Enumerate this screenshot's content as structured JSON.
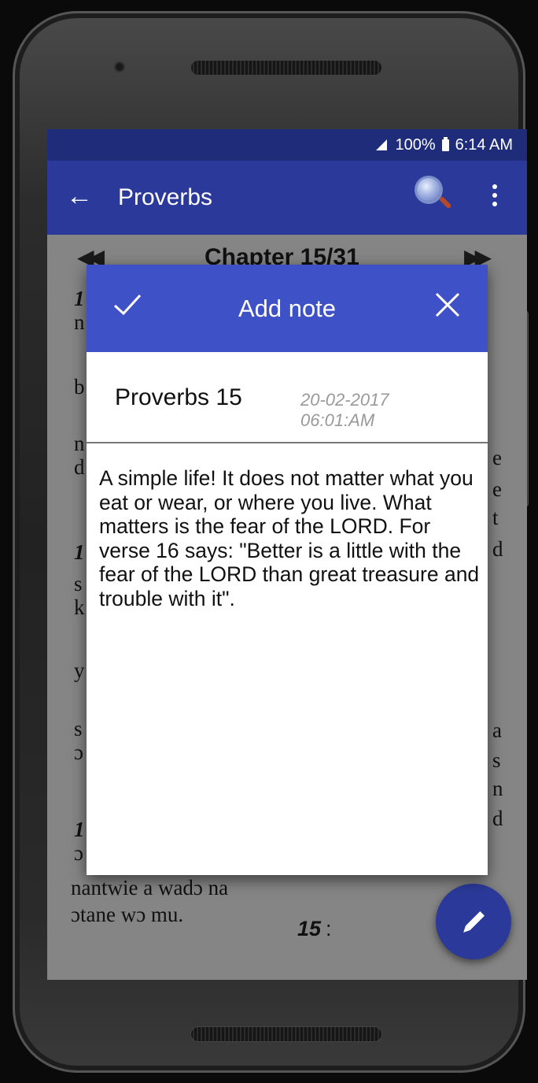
{
  "status_bar": {
    "battery": "100%",
    "time": "6:14 AM",
    "icons": [
      "signal-icon",
      "battery-icon"
    ]
  },
  "toolbar": {
    "title": "Proverbs",
    "icons": [
      "back-arrow-icon",
      "search-icon",
      "more-vert-icon"
    ]
  },
  "chapter_nav": {
    "title": "Chapter 15/31",
    "prev_icon": "double-chevron-left-icon",
    "next_icon": "double-chevron-right-icon"
  },
  "background_text": {
    "left_fragments": [
      "1",
      "n",
      "b",
      "n",
      "d",
      "1",
      "s",
      "k",
      "y",
      "s",
      "ɔ",
      "1",
      "ɔ"
    ],
    "right_fragments": [
      "e",
      "e",
      "t",
      "d",
      "a",
      "s",
      "n",
      "d"
    ],
    "line1": "nantwie a wadɔ na",
    "line2": "ɔtane wɔ mu.",
    "verse_ref": "15",
    "verse_sep": ":"
  },
  "dialog": {
    "title": "Add note",
    "confirm_icon": "check-icon",
    "close_icon": "close-icon",
    "note_reference": "Proverbs 15",
    "note_date": "20-02-2017",
    "note_time": "06:01:AM",
    "note_text": "A simple life! It does not matter what you eat or wear, or where you live. What matters is the fear of the LORD. For verse 16 says: \"Better is a little with the fear of the LORD than great treasure and trouble with it\"."
  },
  "fab": {
    "icon": "pencil-icon"
  },
  "colors": {
    "status_bar": "#1f2c7a",
    "toolbar": "#2b3a9a",
    "dialog_header": "#3f51c6",
    "fab": "#2b3a9a"
  }
}
